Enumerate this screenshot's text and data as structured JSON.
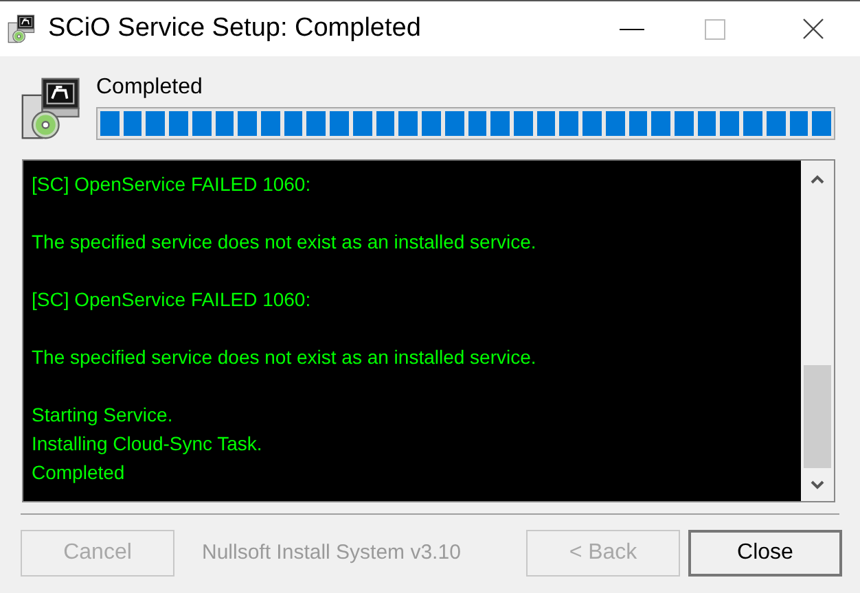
{
  "window": {
    "title": "SCiO Service Setup: Completed"
  },
  "status": {
    "label": "Completed",
    "progress": {
      "level": 1
    }
  },
  "log": {
    "blocks": [
      [
        "[SC] OpenService FAILED 1060:"
      ],
      [
        "The specified service does not exist as an installed service."
      ],
      [
        "[SC] OpenService FAILED 1060:"
      ],
      [
        "The specified service does not exist as an installed service."
      ],
      [
        "Starting Service.",
        "Installing Cloud-Sync Task.",
        "Completed"
      ]
    ]
  },
  "branding": "Nullsoft Install System v3.10",
  "buttons": [
    {
      "label": "Cancel",
      "disabled": true
    },
    {
      "kind": "spacer"
    },
    {
      "label": "< Back",
      "disabled": true
    },
    {
      "label": "Close",
      "disabled": false,
      "default": true
    }
  ]
}
